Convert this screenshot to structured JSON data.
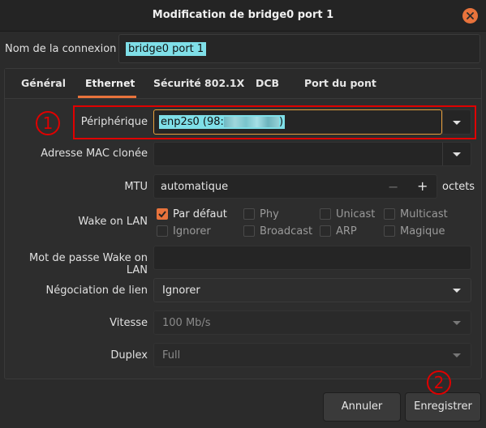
{
  "window": {
    "title": "Modification de bridge0 port 1"
  },
  "connection": {
    "label": "Nom de la connexion",
    "value": "bridge0 port 1"
  },
  "tabs": [
    "Général",
    "Ethernet",
    "Sécurité 802.1X",
    "DCB",
    "Port du pont"
  ],
  "active_tab": "Ethernet",
  "ethernet": {
    "device_label": "Périphérique",
    "device_value": "enp2s0 (98:",
    "mac_label": "Adresse MAC clonée",
    "mac_value": "",
    "mtu_label": "MTU",
    "mtu_value": "automatique",
    "mtu_minus": "−",
    "mtu_plus": "+",
    "mtu_unit": "octets",
    "wol_label": "Wake on LAN",
    "wol_options": {
      "default": "Par défaut",
      "phy": "Phy",
      "unicast": "Unicast",
      "multicast": "Multicast",
      "ignore": "Ignorer",
      "broadcast": "Broadcast",
      "arp": "ARP",
      "magic": "Magique"
    },
    "wol_checked": [
      "default"
    ],
    "wol_password_label": "Mot de passe Wake on LAN",
    "negotiation_label": "Négociation de lien",
    "negotiation_value": "Ignorer",
    "speed_label": "Vitesse",
    "speed_value": "100 Mb/s",
    "duplex_label": "Duplex",
    "duplex_value": "Full"
  },
  "annotations": {
    "one": "1",
    "two": "2"
  },
  "footer": {
    "cancel": "Annuler",
    "save": "Enregistrer"
  },
  "colors": {
    "accent": "#e8733c",
    "annotation": "#e00000",
    "selection": "#7fdfe8"
  }
}
